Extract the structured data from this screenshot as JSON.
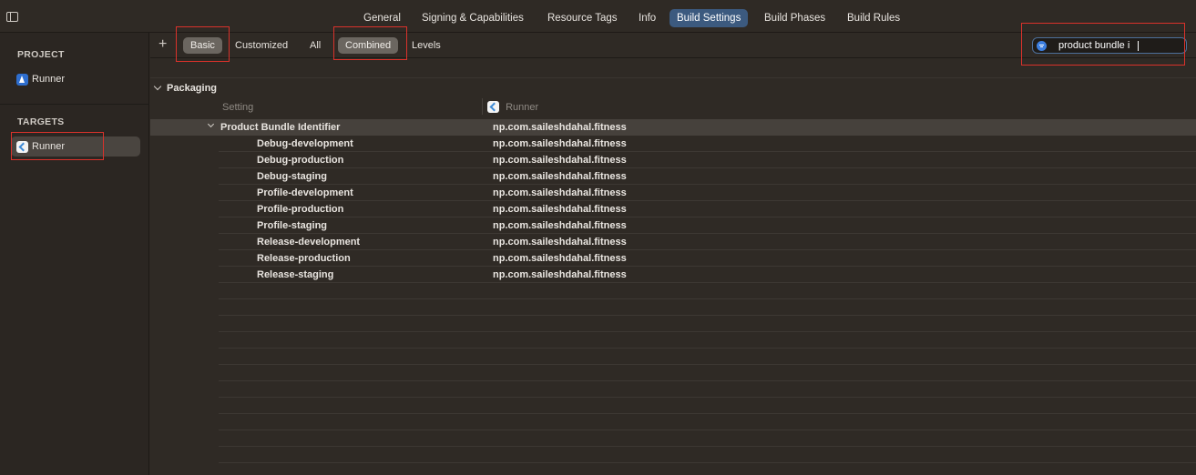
{
  "tabs": [
    {
      "label": "General"
    },
    {
      "label": "Signing & Capabilities"
    },
    {
      "label": "Resource Tags"
    },
    {
      "label": "Info"
    },
    {
      "label": "Build Settings"
    },
    {
      "label": "Build Phases"
    },
    {
      "label": "Build Rules"
    }
  ],
  "sidebar": {
    "project_title": "PROJECT",
    "project_item": "Runner",
    "targets_title": "TARGETS",
    "target_item": "Runner"
  },
  "filter": {
    "plus": "+",
    "basic": "Basic",
    "customized": "Customized",
    "all": "All",
    "combined": "Combined",
    "levels": "Levels",
    "search_value": "product bundle i"
  },
  "table": {
    "group": "Packaging",
    "col_setting": "Setting",
    "col_target": "Runner",
    "parent": {
      "name": "Product Bundle Identifier",
      "value": "np.com.saileshdahal.fitness"
    },
    "rows": [
      {
        "name": "Debug-development",
        "value": "np.com.saileshdahal.fitness"
      },
      {
        "name": "Debug-production",
        "value": "np.com.saileshdahal.fitness"
      },
      {
        "name": "Debug-staging",
        "value": "np.com.saileshdahal.fitness"
      },
      {
        "name": "Profile-development",
        "value": "np.com.saileshdahal.fitness"
      },
      {
        "name": "Profile-production",
        "value": "np.com.saileshdahal.fitness"
      },
      {
        "name": "Profile-staging",
        "value": "np.com.saileshdahal.fitness"
      },
      {
        "name": "Release-development",
        "value": "np.com.saileshdahal.fitness"
      },
      {
        "name": "Release-production",
        "value": "np.com.saileshdahal.fitness"
      },
      {
        "name": "Release-staging",
        "value": "np.com.saileshdahal.fitness"
      }
    ]
  },
  "colors": {
    "background": "#2f2a25",
    "active_tab": "#3c5a7f",
    "highlight_box": "#d9322b"
  }
}
